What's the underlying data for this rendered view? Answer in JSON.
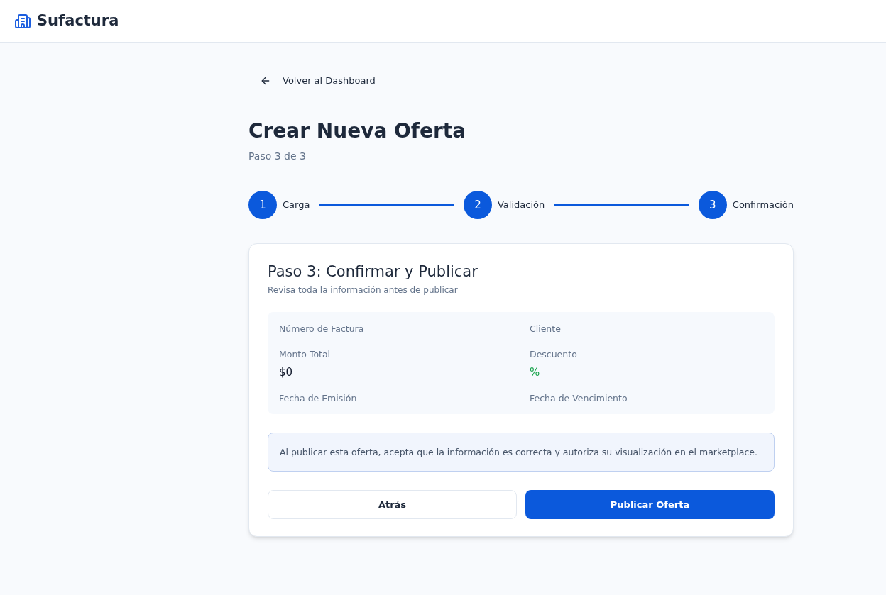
{
  "app": {
    "name": "Sufactura"
  },
  "back_link": "Volver al Dashboard",
  "title": "Crear Nueva Oferta",
  "subtitle": "Paso 3 de 3",
  "steps": [
    {
      "number": "1",
      "label": "Carga",
      "done": true
    },
    {
      "number": "2",
      "label": "Validación",
      "done": true
    },
    {
      "number": "3",
      "label": "Confirmación",
      "done": true
    }
  ],
  "card": {
    "title": "Paso 3: Confirmar y Publicar",
    "subtitle": "Revisa toda la información antes de publicar",
    "fields": [
      {
        "label": "Número de Factura"
      },
      {
        "label": "Cliente"
      },
      {
        "label": "Monto Total",
        "value": "$0",
        "accent": false
      },
      {
        "label": "Descuento",
        "value": "%",
        "accent": true
      },
      {
        "label": "Fecha de Emisión"
      },
      {
        "label": "Fecha de Vencimiento"
      }
    ],
    "notice": "Al publicar esta oferta, acepta que la información es correcta y autoriza su visualización en el marketplace.",
    "buttons": [
      {
        "label": "Atrás",
        "kind": "secondary"
      },
      {
        "label": "Publicar Oferta",
        "kind": "primary"
      }
    ]
  }
}
